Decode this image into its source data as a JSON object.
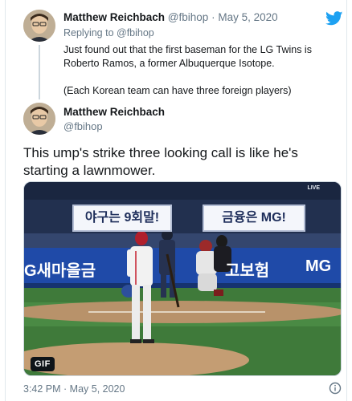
{
  "reply": {
    "name": "Matthew Reichbach",
    "handle": "@fbihop",
    "separator": "·",
    "date": "May 5, 2020",
    "replying_to": "Replying to @fbihop",
    "paragraph1": "Just found out that the first baseman for the LG Twins is Roberto Ramos, a former Albuquerque Isotope.",
    "paragraph2": "(Each Korean team can have three foreign players)"
  },
  "tweet": {
    "name": "Matthew Reichbach",
    "handle": "@fbihop",
    "text": "This ump's strike three looking call is like he's starting a lawnmower.",
    "timestamp": "3:42 PM · May 5, 2020"
  },
  "media": {
    "badge": "GIF",
    "live_tag": "LIVE",
    "sign_left": "야구는 9회말!",
    "sign_right": "금융은 MG!",
    "band_left": "G새마을금",
    "band_right": "고보험",
    "band_mg": "MG"
  },
  "icons": {
    "brand": "twitter-bird-icon",
    "info": "info-icon"
  },
  "colors": {
    "twitter_blue": "#1da1f2",
    "muted": "#657786",
    "thread_line": "#ccd6dd"
  }
}
